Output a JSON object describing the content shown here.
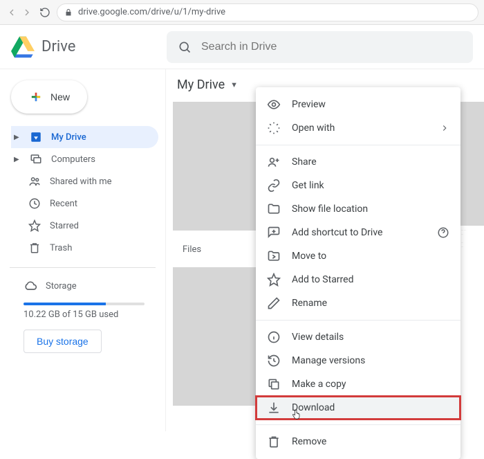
{
  "browser": {
    "url": "drive.google.com/drive/u/1/my-drive"
  },
  "header": {
    "product": "Drive",
    "search_placeholder": "Search in Drive"
  },
  "sidebar": {
    "new_label": "New",
    "items": [
      {
        "label": "My Drive"
      },
      {
        "label": "Computers"
      },
      {
        "label": "Shared with me"
      },
      {
        "label": "Recent"
      },
      {
        "label": "Starred"
      },
      {
        "label": "Trash"
      }
    ],
    "storage_label": "Storage",
    "storage_used_text": "10.22 GB of 15 GB used",
    "storage_pct": 68,
    "buy_label": "Buy storage"
  },
  "content": {
    "breadcrumb": "My Drive",
    "files_label": "Files"
  },
  "context_menu": {
    "items": [
      {
        "label": "Preview"
      },
      {
        "label": "Open with"
      },
      {
        "label": "Share"
      },
      {
        "label": "Get link"
      },
      {
        "label": "Show file location"
      },
      {
        "label": "Add shortcut to Drive"
      },
      {
        "label": "Move to"
      },
      {
        "label": "Add to Starred"
      },
      {
        "label": "Rename"
      },
      {
        "label": "View details"
      },
      {
        "label": "Manage versions"
      },
      {
        "label": "Make a copy"
      },
      {
        "label": "Download"
      },
      {
        "label": "Remove"
      }
    ]
  }
}
